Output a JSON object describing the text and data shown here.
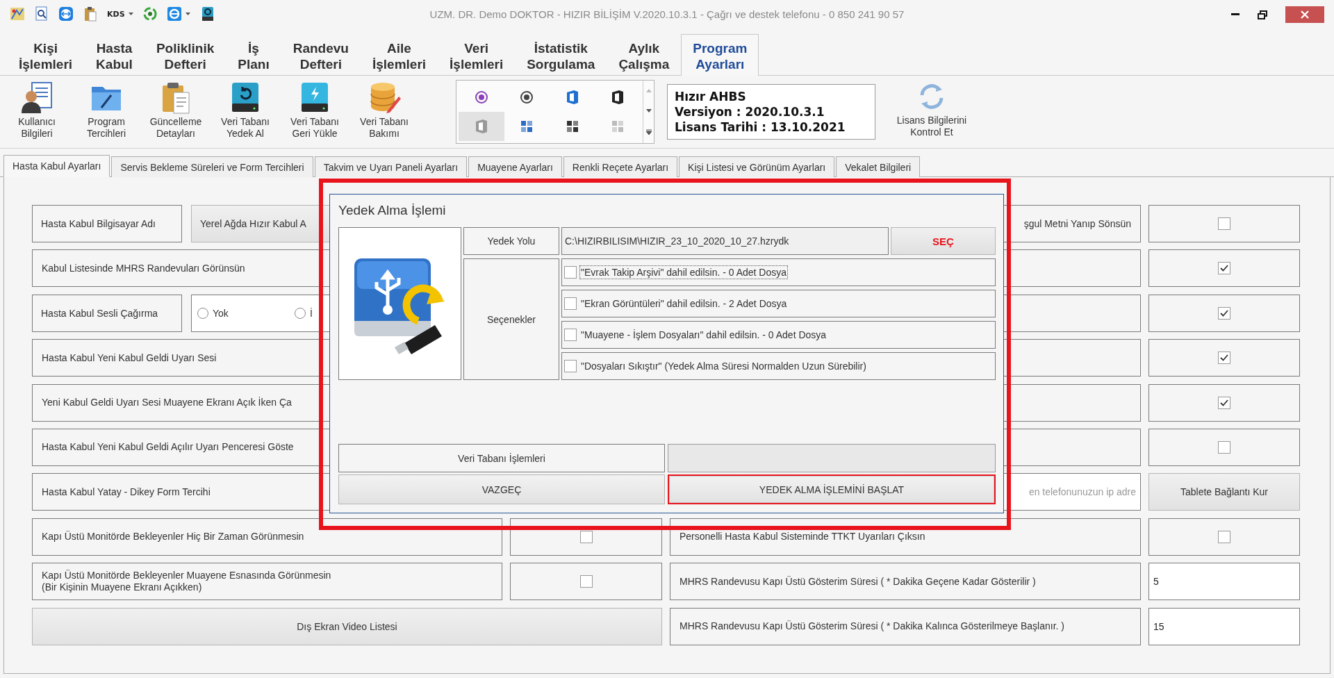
{
  "window": {
    "title": "UZM. DR. Demo DOKTOR - HIZIR BİLİŞİM V.2020.10.3.1 - Çağrı ve destek telefonu - 0 850 241 90 57"
  },
  "quick_access": [
    {
      "kind": "map"
    },
    {
      "kind": "search"
    },
    {
      "kind": "remote"
    },
    {
      "kind": "clipboard"
    },
    {
      "kind": "kds",
      "label": "KDS",
      "dropdown": true
    },
    {
      "kind": "recycle"
    },
    {
      "kind": "globe",
      "dropdown": true
    },
    {
      "kind": "drive"
    }
  ],
  "ribbon_tabs": [
    {
      "label": "Kişi\nİşlemleri",
      "selected": false
    },
    {
      "label": "Hasta\nKabul",
      "selected": false
    },
    {
      "label": "Poliklinik\nDefteri",
      "selected": false
    },
    {
      "label": "İş\nPlanı",
      "selected": false
    },
    {
      "label": "Randevu\nDefteri",
      "selected": false
    },
    {
      "label": "Aile\nİşlemleri",
      "selected": false
    },
    {
      "label": "Veri\nİşlemleri",
      "selected": false
    },
    {
      "label": "İstatistik\nSorgulama",
      "selected": false
    },
    {
      "label": "Aylık\nÇalışma",
      "selected": false
    },
    {
      "label": "Program\nAyarları",
      "selected": true
    }
  ],
  "toolbar": [
    {
      "kind": "user",
      "label": "Kullanıcı\nBilgileri"
    },
    {
      "kind": "folder",
      "label": "Program\nTercihleri"
    },
    {
      "kind": "clipboard",
      "label": "Güncelleme\nDetayları"
    },
    {
      "kind": "drive_backup",
      "label": "Veri Tabanı\nYedek Al"
    },
    {
      "kind": "drive_restore",
      "label": "Veri Tabanı\nGeri Yükle"
    },
    {
      "kind": "database",
      "label": "Veri Tabanı\nBakımı"
    }
  ],
  "gallery": [
    {
      "kind": "disc_purple",
      "selected": false
    },
    {
      "kind": "disc_dark",
      "selected": false
    },
    {
      "kind": "panel_blue",
      "selected": false
    },
    {
      "kind": "panel_black",
      "selected": false
    },
    {
      "kind": "panel_gray",
      "selected": true
    },
    {
      "kind": "tiles_blue",
      "selected": false
    },
    {
      "kind": "tiles_dark",
      "selected": false
    },
    {
      "kind": "tiles_light",
      "selected": false
    }
  ],
  "info_box": {
    "lines": [
      "Hızır AHBS",
      "Versiyon : 2020.10.3.1",
      "Lisans Tarihi : 13.10.2021"
    ]
  },
  "license_button": {
    "label": "Lisans Bilgilerini\nKontrol Et"
  },
  "sub_tabs": [
    {
      "label": "Hasta Kabul Ayarları",
      "selected": true
    },
    {
      "label": "Servis Bekleme Süreleri ve Form Tercihleri",
      "selected": false
    },
    {
      "label": "Takvim ve Uyarı Paneli Ayarları",
      "selected": false
    },
    {
      "label": "Muayene Ayarları",
      "selected": false
    },
    {
      "label": "Renkli Reçete Ayarları",
      "selected": false
    },
    {
      "label": "Kişi Listesi ve Görünüm Ayarları",
      "selected": false
    },
    {
      "label": "Vekalet Bilgileri",
      "selected": false
    }
  ],
  "rows": [
    {
      "left": {
        "kind": "label_button",
        "label": "Hasta Kabul Bilgisayar Adı",
        "button": "Yerel Ağda Hızır Kabul A"
      },
      "right": {
        "kind": "tail_label_check",
        "label": "şgul Metni Yanıp Sönsün",
        "checked": false
      }
    },
    {
      "left": {
        "kind": "label",
        "label": "Kabul Listesinde MHRS Randevuları Görünsün"
      },
      "right": {
        "kind": "label_check",
        "checked": true
      }
    },
    {
      "left": {
        "kind": "label_radio",
        "label": "Hasta Kabul Sesli Çağırma",
        "options": [
          {
            "label": "Yok",
            "selected": false
          },
          {
            "label": "İ",
            "selected": false
          }
        ]
      },
      "right": {
        "kind": "label_check",
        "checked": true
      }
    },
    {
      "left": {
        "kind": "label",
        "label": "Hasta Kabul Yeni Kabul Geldi Uyarı Sesi"
      },
      "right": {
        "kind": "label_check",
        "checked": true
      }
    },
    {
      "left": {
        "kind": "label",
        "label": "Yeni Kabul Geldi Uyarı Sesi Muayene Ekranı Açık İken Ça"
      },
      "right": {
        "kind": "label_check",
        "checked": true
      }
    },
    {
      "left": {
        "kind": "label",
        "label": "Hasta Kabul Yeni Kabul Geldi Açılır Uyarı Penceresi Göste"
      },
      "right": {
        "kind": "label_check",
        "checked": false
      }
    },
    {
      "left": {
        "kind": "label",
        "label": "Hasta Kabul Yatay - Dikey Form Tercihi"
      },
      "right": {
        "kind": "input_button",
        "placeholder": "en telefonunuzun ip adre",
        "button": "Tablete Bağlantı Kur"
      }
    },
    {
      "left": {
        "kind": "label_check",
        "label": "Kapı Üstü Monitörde Bekleyenler Hiç Bir Zaman Görünmesin",
        "checked": false
      },
      "right": {
        "kind": "label_check",
        "label": "Personelli Hasta Kabul Sisteminde TTKT Uyarıları Çıksın",
        "checked": false
      }
    },
    {
      "left": {
        "kind": "label_check",
        "label": "Kapı Üstü Monitörde Bekleyenler Muayene Esnasında Görünmesin\n(Bir Kişinin Muayene Ekranı Açıkken)",
        "checked": false
      },
      "right": {
        "kind": "label_value",
        "label": "MHRS Randevusu Kapı Üstü Gösterim Süresi ( * Dakika Geçene Kadar Gösterilir )",
        "value": "5"
      }
    },
    {
      "left": {
        "kind": "button",
        "label": "Dış Ekran Video Listesi"
      },
      "right": {
        "kind": "label_value",
        "label": "MHRS Randevusu Kapı Üstü Gösterim Süresi ( * Dakika Kalınca Gösterilmeye Başlanır. )",
        "value": "15"
      }
    }
  ],
  "dialog": {
    "highlighted": true,
    "title": "Yedek Alma İşlemi",
    "path_label": "Yedek Yolu",
    "path": "C:\\HIZIRBILISIM\\HIZIR_23_10_2020_10_27.hzrydk",
    "choose_button": "SEÇ",
    "options_label": "Seçenekler",
    "options": [
      {
        "label": "\"Evrak Takip Arşivi\" dahil edilsin. - 0 Adet Dosya",
        "checked": false,
        "focused": true
      },
      {
        "label": "\"Ekran Görüntüleri\" dahil edilsin. - 2 Adet Dosya",
        "checked": false,
        "focused": false
      },
      {
        "label": "\"Muayene - İşlem Dosyaları\" dahil edilsin. - 0 Adet Dosya",
        "checked": false,
        "focused": false
      },
      {
        "label": "\"Dosyaları Sıkıştır\" (Yedek Alma Süresi Normalden Uzun Sürebilir)",
        "checked": false,
        "focused": false
      }
    ],
    "section_label": "Veri Tabanı İşlemleri",
    "buttons": [
      {
        "label": "VAZGEÇ",
        "highlighted": false
      },
      {
        "label": "YEDEK ALMA İŞLEMİNİ BAŞLAT",
        "highlighted": true
      }
    ]
  }
}
